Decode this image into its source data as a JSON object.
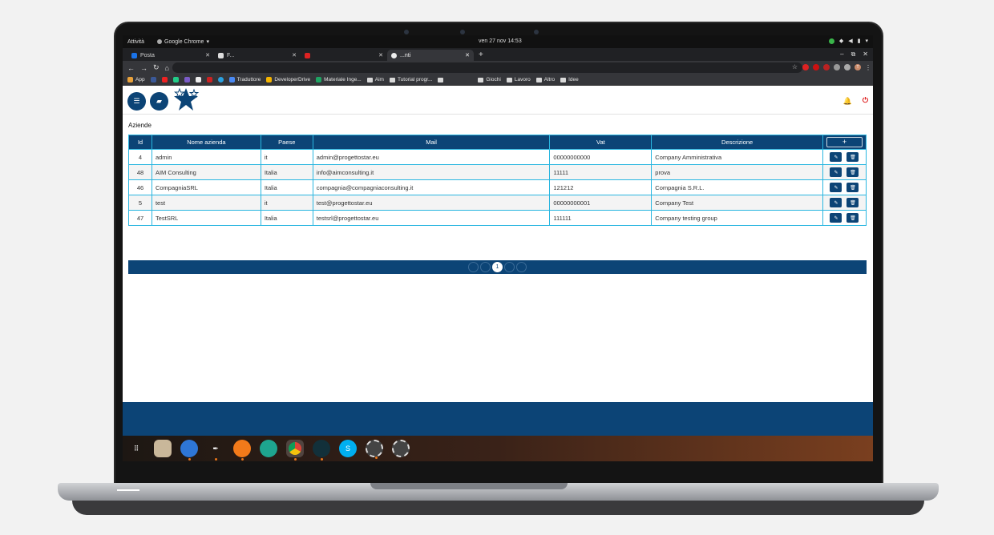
{
  "topbar": {
    "activities": "Attività",
    "app_name": "Google Chrome",
    "clock": "ven 27 nov  14:53"
  },
  "browser": {
    "tabs": [
      {
        "label": "Posta",
        "active": false
      },
      {
        "label": "F...",
        "active": false
      },
      {
        "label": "",
        "active": false
      },
      {
        "label": "...nti",
        "active": true
      }
    ],
    "new_tab": "+",
    "bookmarks": [
      "App",
      "Traduttore",
      "DeveloperDrive",
      "Materiale Inge...",
      "Aim",
      "Tutorial progr...",
      "Giochi",
      "Lavoro",
      "Altro",
      "Idee"
    ],
    "profile_initial": "T"
  },
  "page": {
    "section_title": "Aziende",
    "table": {
      "headers": [
        "Id",
        "Nome azienda",
        "Paese",
        "Mail",
        "Vat",
        "Descrizione"
      ],
      "add_label": "+",
      "rows": [
        {
          "id": "4",
          "nome": "admin",
          "paese": "it",
          "mail": "admin@progettostar.eu",
          "vat": "00000000000",
          "descrizione": "Company Amministrativa"
        },
        {
          "id": "48",
          "nome": "AIM Consulting",
          "paese": "Italia",
          "mail": "info@aimconsulting.it",
          "vat": "11111",
          "descrizione": "prova"
        },
        {
          "id": "46",
          "nome": "CompagniaSRL",
          "paese": "Italia",
          "mail": "compagnia@compagniaconsulting.it",
          "vat": "121212",
          "descrizione": "Compagnia S.R.L."
        },
        {
          "id": "5",
          "nome": "test",
          "paese": "it",
          "mail": "test@progettostar.eu",
          "vat": "00000000001",
          "descrizione": "Company Test"
        },
        {
          "id": "47",
          "nome": "TestSRL",
          "paese": "Italia",
          "mail": "testsrl@progettostar.eu",
          "vat": "111111",
          "descrizione": "Company testing group"
        }
      ]
    },
    "pagination": {
      "current": "1"
    }
  },
  "colors": {
    "primary": "#0c4476",
    "table_border": "#29b6e0",
    "danger": "#dd1111"
  }
}
